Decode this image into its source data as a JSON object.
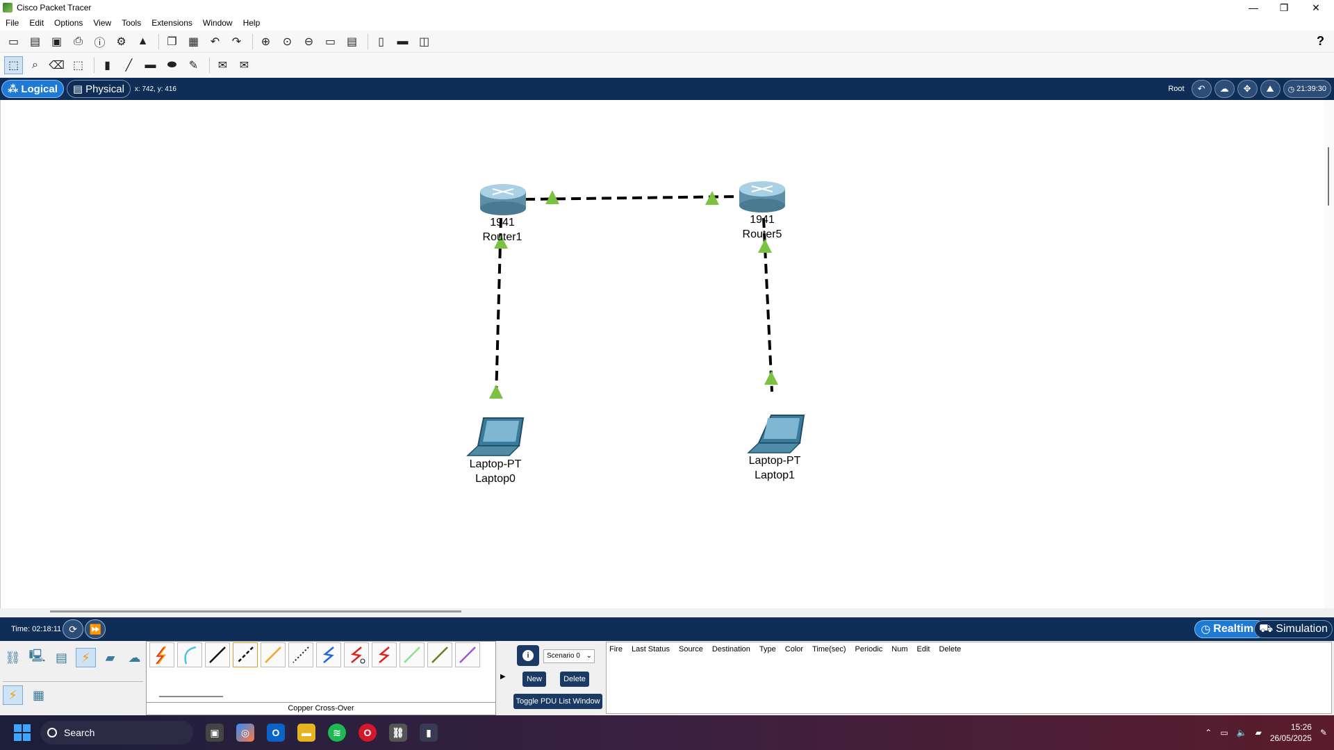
{
  "window": {
    "title": "Cisco Packet Tracer",
    "minimize": "—",
    "maximize": "❐",
    "close": "✕"
  },
  "menu": [
    "File",
    "Edit",
    "Options",
    "View",
    "Tools",
    "Extensions",
    "Window",
    "Help"
  ],
  "toolbar1": {
    "icons": [
      "new-icon",
      "open-icon",
      "save-icon",
      "print-icon",
      "info-icon",
      "wizard-icon",
      "network-info-icon",
      "copy-icon",
      "paste-icon",
      "undo-icon",
      "redo-icon",
      "zoom-in-icon",
      "zoom-reset-icon",
      "zoom-out-icon",
      "drawing-palette-icon",
      "custom-device-icon",
      "viewport-icon",
      "cluster-icon",
      "pdu-window-icon"
    ],
    "help": "?"
  },
  "toolbar2": {
    "icons": [
      "select-icon",
      "inspect-icon",
      "delete-icon",
      "resize-icon",
      "note-icon",
      "line-icon",
      "rectangle-icon",
      "ellipse-icon",
      "freeform-icon",
      "simple-pdu-icon",
      "complex-pdu-icon"
    ]
  },
  "nav": {
    "logical": "Logical",
    "physical": "Physical",
    "coords": "x: 742, y: 416",
    "root": "Root",
    "clock": "21:39:30"
  },
  "devices": [
    {
      "id": "router1",
      "model": "1941",
      "name": "Router1"
    },
    {
      "id": "router5",
      "model": "1941",
      "name": "Router5"
    },
    {
      "id": "laptop0",
      "model": "Laptop-PT",
      "name": "Laptop0"
    },
    {
      "id": "laptop1",
      "model": "Laptop-PT",
      "name": "Laptop1"
    }
  ],
  "status": {
    "time": "Time: 02:18:11",
    "realtime": "Realtime",
    "simulation": "Simulation"
  },
  "cables": {
    "selected_name": "Copper Cross-Over",
    "types": [
      "automatic",
      "console",
      "copper-straight",
      "copper-cross",
      "fiber",
      "phone",
      "coaxial",
      "serial-dce",
      "serial-dte",
      "octal",
      "iot-custom",
      "usb"
    ]
  },
  "scenario": {
    "selected": "Scenario 0",
    "new": "New",
    "delete": "Delete",
    "toggle": "Toggle PDU List Window"
  },
  "pdu_columns": [
    "Fire",
    "Last Status",
    "Source",
    "Destination",
    "Type",
    "Color",
    "Time(sec)",
    "Periodic",
    "Num",
    "Edit",
    "Delete"
  ],
  "taskbar": {
    "search": "Search",
    "time": "15:26",
    "date": "26/05/2025"
  },
  "colors": {
    "accent": "#1f7ad6",
    "navbar": "#0e2e57",
    "link_up": "#7cc242"
  }
}
